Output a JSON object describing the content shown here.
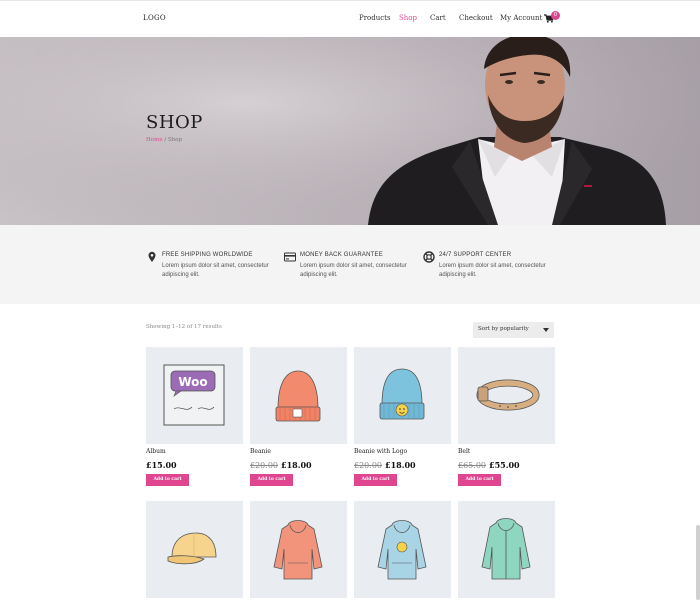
{
  "header": {
    "logo": "LOGO",
    "nav": [
      "Products",
      "Shop",
      "Cart",
      "Checkout",
      "My Account"
    ],
    "active_nav": "Shop",
    "cart_count": "0"
  },
  "hero": {
    "title": "SHOP",
    "breadcrumb_home": "Home",
    "breadcrumb_sep": "/",
    "breadcrumb_current": "Shop"
  },
  "features": [
    {
      "icon": "map-pin-icon",
      "title": "FREE SHIPPING WORLDWIDE",
      "text": "Lorem ipsum dolor sit amet, consectetur adipiscing elit."
    },
    {
      "icon": "credit-card-icon",
      "title": "MONEY BACK GUARANTEE",
      "text": "Lorem ipsum dolor sit amet, consectetur adipiscing elit."
    },
    {
      "icon": "support-lifebuoy-icon",
      "title": "24/7 SUPPORT CENTER",
      "text": "Lorem ipsum dolor sit amet, consectetur adipiscing elit."
    }
  ],
  "toolbar": {
    "showing": "Showing 1–12 of 17 results",
    "sort_selected": "Sort by popularity"
  },
  "products": [
    {
      "name": "Album",
      "old_price": "",
      "price": "£15.00",
      "button": "Add to cart"
    },
    {
      "name": "Beanie",
      "old_price": "£20.00",
      "price": "£18.00",
      "button": "Add to cart"
    },
    {
      "name": "Beanie with Logo",
      "old_price": "£20.00",
      "price": "£18.00",
      "button": "Add to cart"
    },
    {
      "name": "Belt",
      "old_price": "£65.00",
      "price": "£55.00",
      "button": "Add to cart"
    }
  ],
  "colors": {
    "accent": "#e0468f",
    "thumb_bg": "#e9edf1",
    "features_bg": "#f4f4f4"
  }
}
